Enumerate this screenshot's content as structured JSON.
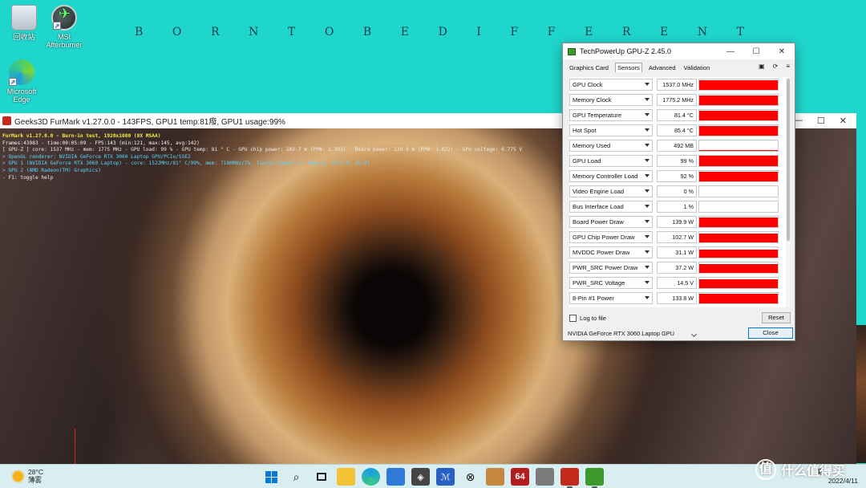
{
  "desktop": {
    "icons": [
      {
        "label": "回收站",
        "icon": "recycle-bin-icon"
      },
      {
        "label": "MSI\nAfterburner",
        "icon": "msi-afterburner-icon"
      },
      {
        "label": "Microsoft\nEdge",
        "icon": "edge-icon"
      }
    ],
    "wallpaper_letters": [
      "B",
      "O",
      "R",
      "N",
      "T",
      "O",
      "B",
      "E",
      "D",
      "I",
      "F",
      "F",
      "E",
      "R",
      "E",
      "N",
      "T"
    ]
  },
  "furmark": {
    "title": "Geeks3D FurMark v1.27.0.0 - 143FPS, GPU1 temp:81癈, GPU1 usage:99%",
    "overlay": [
      "FurMark v1.27.0.0 - Burn-in test, 1920x1080 (8X MSAA)",
      "Frames:43983 - time:00:05:09 - FPS:143 (min:121, max:145, avg:142)",
      "[ GPU-Z ] core: 1537 MHz - mem: 1775 MHz - GPU load: 99 % - GPU temp: 81 ° C - GPU chip power: 102.7 W (PPW: 1.393) - Board power: 139.9 W (PPW: 1.022) - GPU voltage: 0.775 V",
      "> OpenGL renderer: NVIDIA GeForce RTX 3060 Laptop GPU/PCIe/SSE2",
      "> GPU 1 (NVIDIA GeForce RTX 3060 Laptop) - core: 1522MHz/81° C/99%, mem: 7100MHz/7%, limits:[power:1, temp:0, volt:0, OV:0]",
      "> GPU 2 (AMD Radeon(TM) Graphics)",
      "- F1: toggle help"
    ]
  },
  "gpuz": {
    "title": "TechPowerUp GPU-Z 2.45.0",
    "tabs": [
      "Graphics Card",
      "Sensors",
      "Advanced",
      "Validation"
    ],
    "active_tab": "Sensors",
    "sensors": [
      {
        "label": "GPU Clock",
        "value": "1537.0 MHz",
        "fill": 0.95
      },
      {
        "label": "Memory Clock",
        "value": "1775.2 MHz",
        "fill": 0.95
      },
      {
        "label": "GPU Temperature",
        "value": "81.4 °C",
        "fill": 0.9
      },
      {
        "label": "Hot Spot",
        "value": "85.4 °C",
        "fill": 0.9
      },
      {
        "label": "Memory Used",
        "value": "492 MB",
        "fill": 0.1
      },
      {
        "label": "GPU Load",
        "value": "99 %",
        "fill": 0.99
      },
      {
        "label": "Memory Controller Load",
        "value": "92 %",
        "fill": 0.92
      },
      {
        "label": "Video Engine Load",
        "value": "0 %",
        "fill": 0
      },
      {
        "label": "Bus Interface Load",
        "value": "1 %",
        "fill": 0.02
      },
      {
        "label": "Board Power Draw",
        "value": "139.9 W",
        "fill": 0.9
      },
      {
        "label": "GPU Chip Power Draw",
        "value": "102.7 W",
        "fill": 0.85
      },
      {
        "label": "MVDDC Power Draw",
        "value": "31.1 W",
        "fill": 0.8
      },
      {
        "label": "PWR_SRC Power Draw",
        "value": "37.2 W",
        "fill": 0.85
      },
      {
        "label": "PWR_SRC Voltage",
        "value": "14.5 V",
        "fill": 0.85
      },
      {
        "label": "8-Pin #1 Power",
        "value": "133.8 W",
        "fill": 0.9
      }
    ],
    "log_to_file": "Log to file",
    "reset": "Reset",
    "gpu_select": "NVIDIA GeForce RTX 3060 Laptop GPU",
    "close": "Close",
    "colors": {
      "graph": "#ff0000"
    }
  },
  "taskbar": {
    "weather_temp": "28°C",
    "weather_desc": "薄雾",
    "apps": [
      "start",
      "search",
      "task-view",
      "file-explorer",
      "edge",
      "store",
      "unity",
      "app-m",
      "xbox",
      "app-6",
      "64",
      "app-8",
      "furmark",
      "gpuz"
    ],
    "tray_top": "英",
    "date": "2022/4/11"
  },
  "watermark": {
    "text": "什么值得买",
    "badge": "值"
  }
}
